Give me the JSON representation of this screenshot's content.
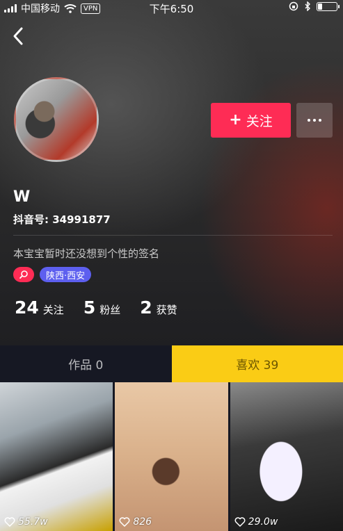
{
  "status_bar": {
    "carrier": "中国移动",
    "vpn": "VPN",
    "time": "下午6:50",
    "battery_level": 0.25
  },
  "profile": {
    "follow_label": "关注",
    "nickname": "W",
    "douyin_id": "抖音号: 34991877",
    "signature": "本宝宝暂时还没想到个性的签名",
    "location_tag": "陕西·西安"
  },
  "stats": [
    {
      "num": "24",
      "label": "关注"
    },
    {
      "num": "5",
      "label": "粉丝"
    },
    {
      "num": "2",
      "label": "获赞"
    }
  ],
  "tabs": {
    "works": "作品 0",
    "likes": "喜欢 39"
  },
  "videos": [
    {
      "likes": "55.7w"
    },
    {
      "likes": "826"
    },
    {
      "likes": "29.0w"
    }
  ],
  "colors": {
    "accent": "#fe2c55",
    "location_tag": "#5d5fef",
    "active_tab": "#facc15",
    "background": "#161823"
  }
}
